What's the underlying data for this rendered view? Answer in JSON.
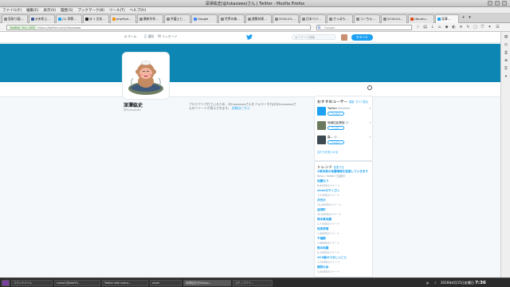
{
  "window": {
    "title": "深澤紘史(@fukazawa)さん | Twitter - Mozilla Firefox"
  },
  "menubar": [
    "ファイル(F)",
    "編集(E)",
    "表示(V)",
    "履歴(S)",
    "ブックマーク(B)",
    "ツール(T)",
    "ヘルプ(H)"
  ],
  "tabs": [
    {
      "label": "見取り図(..."
    },
    {
      "label": "@未知上..."
    },
    {
      "label": "(1) 季節..."
    },
    {
      "label": "@ 1 古花..."
    },
    {
      "label": "phpMyA..."
    },
    {
      "label": "最新作作..."
    },
    {
      "label": "弁護士と..."
    },
    {
      "label": "Google"
    },
    {
      "label": "世界の森..."
    },
    {
      "label": "建築技術..."
    },
    {
      "label": "2016-03-..."
    },
    {
      "label": "日本ベジ..."
    },
    {
      "label": "さっぽろ..."
    },
    {
      "label": "コノちゃ..."
    },
    {
      "label": "2016-04..."
    },
    {
      "label": "Ubuntu..."
    },
    {
      "label": "深澤..."
    }
  ],
  "navbar": {
    "identity": "twitter, Inc. (US)",
    "url": "https://twitter.com/fukazawa",
    "search_placeholder": "Google"
  },
  "twitter": {
    "nav": [
      {
        "icon": "home-icon",
        "label": "ホーム"
      },
      {
        "icon": "moments-icon",
        "label": "通知"
      },
      {
        "icon": "message-icon",
        "label": "メッセージ"
      }
    ],
    "search_placeholder": "キーワード検索",
    "tweet_label": "ツイート"
  },
  "profile": {
    "name": "深澤紘史",
    "handle": "@fukazawa",
    "protected_text": "プロテクトされているため、@fukazawaさんをフォローすれば@fukazawaさんのツイートが表示されます。",
    "protected_link": "詳細はこちら"
  },
  "who_to_follow": {
    "title": "おすすめユーザー",
    "refresh": "更新",
    "view_all": "すべて表示",
    "users": [
      {
        "name": "Twitter",
        "handle": "@twitter",
        "color": "#1da1f2",
        "follow_label": "フォロー"
      },
      {
        "name": "地域住民発信",
        "handle": "@...",
        "color": "#6a7a5e",
        "follow_label": "フォロー"
      },
      {
        "name": "森...",
        "handle": "@...",
        "color": "#3e4a52",
        "follow_label": "フォロー"
      }
    ],
    "find_friends": "友だちを見つける"
  },
  "trends": {
    "title": "トレンド",
    "change": "変更する",
    "items": [
      {
        "name": "#熊本県の地震情報を拡散していきます",
        "count": "News / Twitterで話題中"
      },
      {
        "name": "地震なう",
        "count": "6,843件のツイート"
      },
      {
        "name": "#nexのマイゴン",
        "count": "7,212件のツイート"
      },
      {
        "name": "次元大",
        "count": "10,000件のツイート"
      },
      {
        "name": "益城町",
        "count": "40,000件のツイート"
      },
      {
        "name": "熊本県地震",
        "count": "1,770件のツイート"
      },
      {
        "name": "知床旅情",
        "count": "1,960件のツイート"
      },
      {
        "name": "千種観",
        "count": "1,880件のツイート"
      },
      {
        "name": "熊本地震",
        "count": "9,740件のツイート"
      },
      {
        "name": "#CA勤のうれしいこと",
        "count": "1,220件のツイート"
      },
      {
        "name": "爆発な余",
        "count": "1,620件のツイート"
      }
    ]
  },
  "taskbar": {
    "tasks": [
      "コマンドバトル",
      "sneoz2(@stafYS...",
      "Twitter with malco...",
      "zsnet",
      "深澤紘史(@fukaza...",
      "ステップバイ..."
    ],
    "locale": "jp",
    "clock_date": "2016年4月15日金曜日",
    "clock_time": "7:36"
  },
  "colors": {
    "banner": "#0e86b3",
    "twitter_blue": "#1da1f2"
  }
}
